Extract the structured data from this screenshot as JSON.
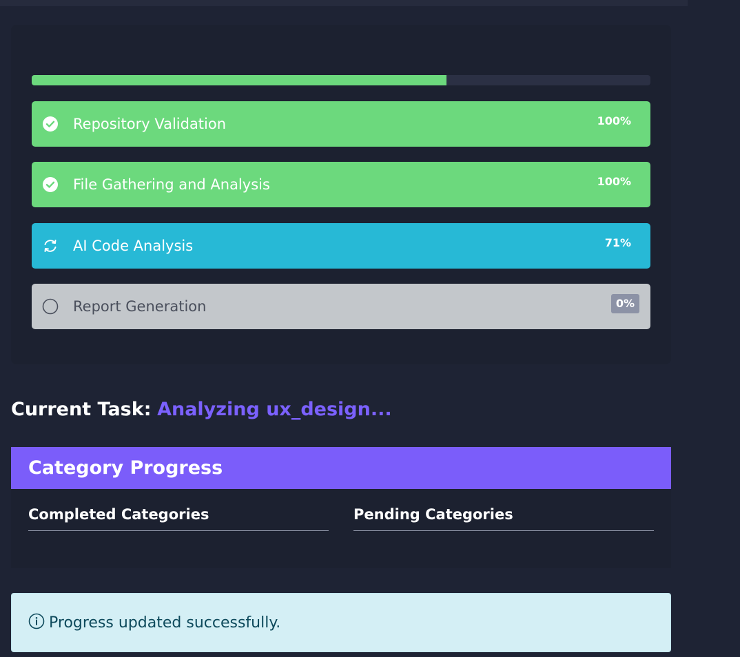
{
  "progress": {
    "overall_percent": 67,
    "steps": [
      {
        "label": "Repository Validation",
        "percent": "100%",
        "status": "done"
      },
      {
        "label": "File Gathering and Analysis",
        "percent": "100%",
        "status": "done"
      },
      {
        "label": "AI Code Analysis",
        "percent": "71%",
        "status": "active"
      },
      {
        "label": "Report Generation",
        "percent": "0%",
        "status": "pending"
      }
    ]
  },
  "current_task": {
    "label": "Current Task:",
    "value": "Analyzing ux_design..."
  },
  "category_progress": {
    "title": "Category Progress",
    "completed_header": "Completed Categories",
    "pending_header": "Pending Categories"
  },
  "alert": {
    "icon": "info-icon",
    "message": "Progress updated successfully."
  },
  "colors": {
    "success": "#6cd97d",
    "active": "#27b9d6",
    "pending": "#c3c7cb",
    "accent": "#7b5dfa",
    "task_value": "#7b61ff",
    "alert_bg": "#d4eff5"
  }
}
